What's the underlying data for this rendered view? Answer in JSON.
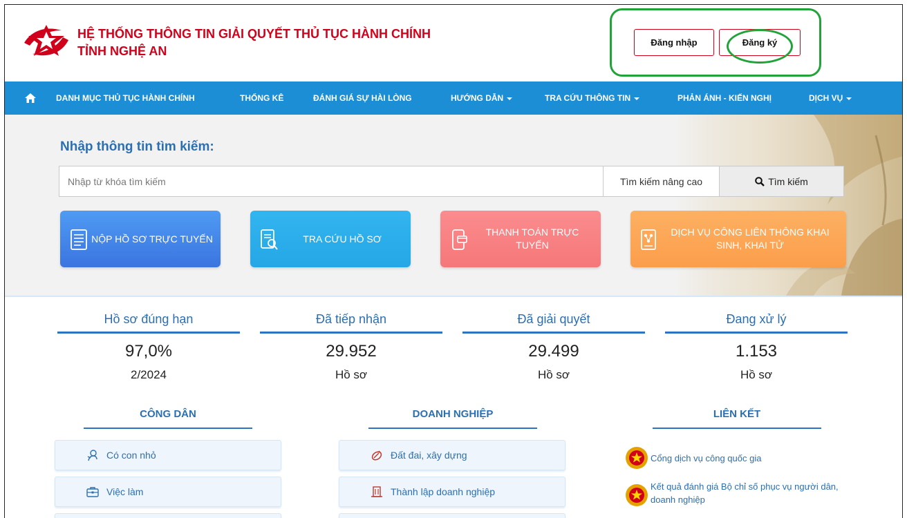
{
  "header": {
    "title_line1": "HỆ THỐNG THÔNG TIN GIẢI QUYẾT THỦ TỤC HÀNH CHÍNH",
    "title_line2": "TỈNH NGHỆ AN",
    "login_label": "Đăng nhập",
    "register_label": "Đăng ký",
    "brand_color": "#d0021b",
    "highlight_color": "#22a33a"
  },
  "nav": {
    "home_icon": "home-icon",
    "color": "#1c8ed6",
    "items": [
      {
        "label": "DANH MỤC THỦ TỤC HÀNH CHÍNH",
        "dropdown": false
      },
      {
        "label": "THỐNG KÊ",
        "dropdown": false
      },
      {
        "label": "ĐÁNH GIÁ SỰ HÀI LÒNG",
        "dropdown": false
      },
      {
        "label": "HƯỚNG DẪN",
        "dropdown": true
      },
      {
        "label": "TRA CỨU THÔNG TIN",
        "dropdown": true
      },
      {
        "label": "PHẢN ÁNH - KIẾN NGHỊ",
        "dropdown": false
      },
      {
        "label": "DỊCH VỤ",
        "dropdown": true
      }
    ]
  },
  "search": {
    "title": "Nhập thông tin tìm kiếm:",
    "placeholder": "Nhập từ khóa tìm kiếm",
    "advanced_label": "Tìm kiếm nâng cao",
    "button_label": "Tìm kiếm"
  },
  "services": [
    {
      "label": "NỘP HỒ SƠ TRỰC TUYẾN",
      "icon": "document-icon"
    },
    {
      "label": "TRA CỨU HỒ SƠ",
      "icon": "search-document-icon"
    },
    {
      "label": "THANH TOÁN TRỰC TUYẾN",
      "icon": "phone-payment-icon"
    },
    {
      "label": "DỊCH VỤ CÔNG LIÊN THÔNG KHAI SINH, KHAI TỬ",
      "icon": "network-document-icon"
    }
  ],
  "stats": [
    {
      "label": "Hồ sơ đúng hạn",
      "value": "97,0%",
      "sub": "2/2024"
    },
    {
      "label": "Đã tiếp nhận",
      "value": "29.952",
      "sub": "Hồ sơ"
    },
    {
      "label": "Đã giải quyết",
      "value": "29.499",
      "sub": "Hồ sơ"
    },
    {
      "label": "Đang xử lý",
      "value": "1.153",
      "sub": "Hồ sơ"
    }
  ],
  "columns": {
    "citizen": {
      "title": "CÔNG DÂN",
      "items": [
        {
          "label": "Có con nhỏ",
          "icon": "baby-icon"
        },
        {
          "label": "Việc làm",
          "icon": "briefcase-icon"
        }
      ]
    },
    "business": {
      "title": "DOANH NGHIỆP",
      "items": [
        {
          "label": "Đất đai, xây dựng",
          "icon": "land-icon"
        },
        {
          "label": "Thành lập doanh nghiệp",
          "icon": "building-icon"
        }
      ]
    },
    "links": {
      "title": "LIÊN KẾT",
      "items": [
        {
          "label": "Cổng dịch vụ công quốc gia",
          "icon": "national-emblem-icon"
        },
        {
          "label": "Kết quả đánh giá Bộ chỉ số phục vụ người dân, doanh nghiệp",
          "icon": "national-emblem-icon"
        }
      ]
    }
  }
}
